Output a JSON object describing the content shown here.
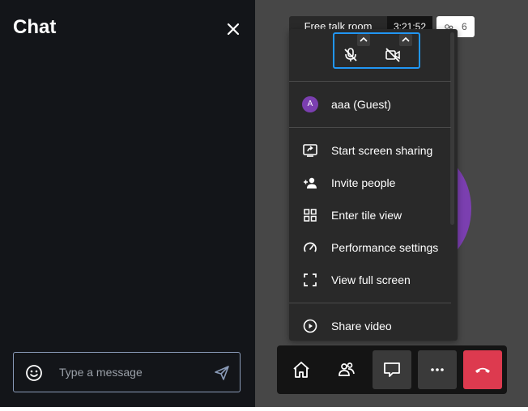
{
  "chat": {
    "title": "Chat",
    "close_icon": "close-icon",
    "input": {
      "placeholder": "Type a message",
      "value": ""
    },
    "emoji_icon": "emoji-smile-icon",
    "send_icon": "send-icon"
  },
  "header": {
    "room_name": "Free talk room",
    "timer": "3:21:52",
    "participant_count": "6",
    "participant_icon": "participants-icon"
  },
  "overflow_menu": {
    "audio_icon": "microphone-muted-icon",
    "video_icon": "camera-off-icon",
    "participant": {
      "initial": "A",
      "name": "aaa (Guest)"
    },
    "items": [
      {
        "label": "Start screen sharing",
        "icon": "screen-share-icon"
      },
      {
        "label": "Invite people",
        "icon": "invite-icon"
      },
      {
        "label": "Enter tile view",
        "icon": "tile-view-icon"
      },
      {
        "label": "Performance settings",
        "icon": "gauge-icon"
      },
      {
        "label": "View full screen",
        "icon": "fullscreen-icon"
      },
      {
        "label": "Share video",
        "icon": "play-circle-icon"
      }
    ]
  },
  "toolbar": {
    "buttons": [
      "home-icon",
      "participants-icon",
      "chat-icon",
      "more-icon",
      "hangup-icon"
    ]
  },
  "colors": {
    "chat_bg": "#131519",
    "stage_bg": "#474747",
    "menu_bg": "#292929",
    "accent_blue": "#2196f3",
    "avatar_purple": "#7b3fb0",
    "hangup_red": "#dd3a4f"
  }
}
